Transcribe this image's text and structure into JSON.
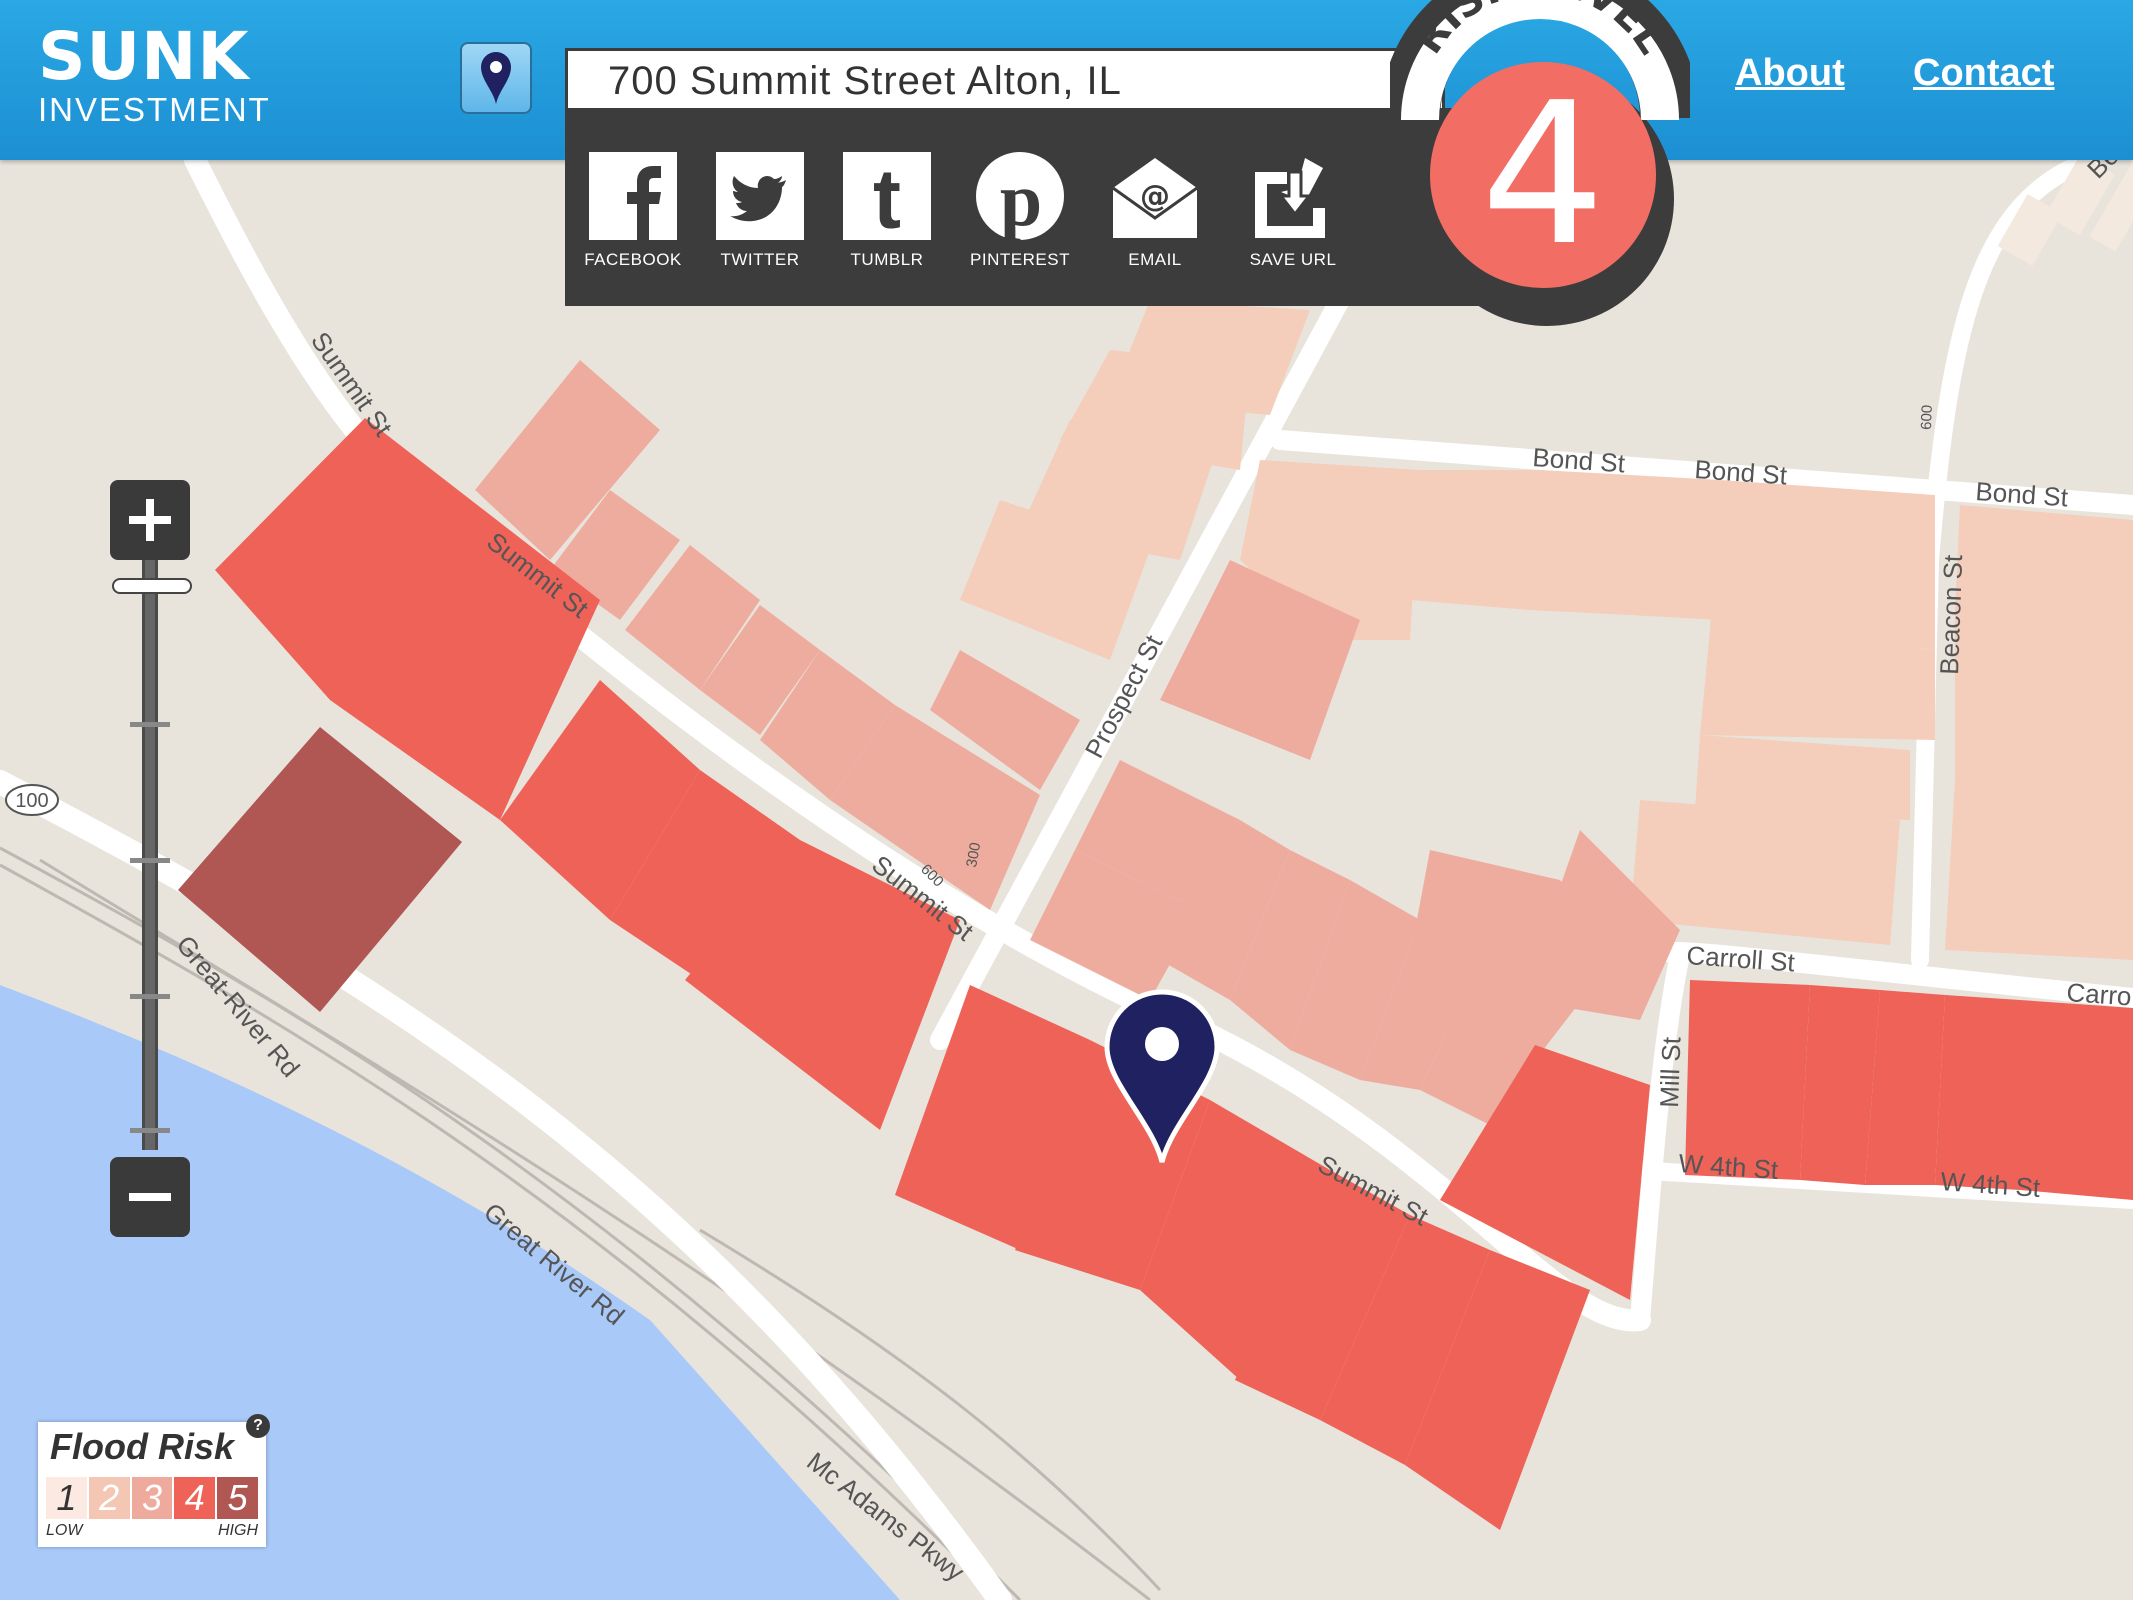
{
  "header": {
    "logo_top": "SUNK",
    "logo_bottom": "INVESTMENT",
    "address": "700 Summit Street Alton, IL",
    "nav": {
      "about": "About",
      "contact": "Contact"
    }
  },
  "share": [
    {
      "label": "FACEBOOK",
      "icon": "facebook-icon"
    },
    {
      "label": "TWITTER",
      "icon": "twitter-icon"
    },
    {
      "label": "TUMBLR",
      "icon": "tumblr-icon"
    },
    {
      "label": "PINTEREST",
      "icon": "pinterest-icon"
    },
    {
      "label": "EMAIL",
      "icon": "email-icon"
    },
    {
      "label": "SAVE URL",
      "icon": "save-url-icon"
    }
  ],
  "risk": {
    "title": "RISK LEVEL",
    "value": "4"
  },
  "map": {
    "streets": {
      "summit_1": "Summit St",
      "summit_2": "Summit St",
      "summit_3": "Summit St",
      "summit_4": "Summit St",
      "prospect": "Prospect St",
      "bond_1": "Bond St",
      "bond_2": "Bond St",
      "bond_3": "Bond St",
      "beacon": "Beacon St",
      "carroll_1": "Carroll St",
      "carroll_2": "Carro",
      "mill": "Mill St",
      "w4th_1": "W 4th St",
      "w4th_2": "W 4th St",
      "great_river_1": "Great-River Rd",
      "great_river_2": "Great River Rd",
      "mcadams": "Mc Adams Pkwy",
      "route": "100",
      "num_600a": "600",
      "num_300": "300",
      "num_600b": "600",
      "be": "Be"
    }
  },
  "legend": {
    "title": "Flood Risk",
    "help": "?",
    "levels": [
      "1",
      "2",
      "3",
      "4",
      "5"
    ],
    "low": "LOW",
    "high": "HIGH"
  },
  "colors": {
    "header": "#24a1e0",
    "panel": "#3c3c3c",
    "risk_accent": "#f26e64",
    "level_1": "#f7e1d8",
    "level_2": "#f4c6b4",
    "level_3": "#eeaa9c",
    "level_4": "#ee6258",
    "level_5": "#b05653",
    "water": "#a8c8f8",
    "pin": "#1f2160"
  }
}
